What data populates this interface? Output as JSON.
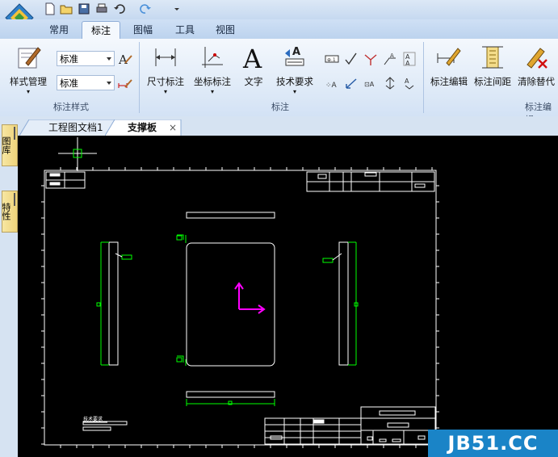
{
  "ribbon_tabs": [
    "常用",
    "标注",
    "图幅",
    "工具",
    "视图"
  ],
  "active_tab": "标注",
  "groups": {
    "style": {
      "label": "标注样式",
      "style_manager": "样式管理",
      "combo1": "标准",
      "combo2": "标准"
    },
    "annotation": {
      "label": "标注",
      "dim": "尺寸标注",
      "coord": "坐标标注",
      "text": "文字",
      "tech": "技术要求"
    },
    "edit": {
      "label": "标注编辑",
      "edit": "标注编辑",
      "spacing": "标注间距",
      "clear": "清除替代"
    }
  },
  "doc_tabs": [
    "工程图文档1",
    "支撑板"
  ],
  "active_doc": "支撑板",
  "side_tabs": [
    "图库",
    "特性"
  ],
  "drawing": {
    "tech_req_label": "技术要求"
  },
  "watermark": "JB51.CC",
  "colors": {
    "ribbon_bg": "#dde9f7",
    "line_white": "#ffffff",
    "line_green": "#00ff00",
    "axis_magenta": "#ff00ff",
    "watermark_bg": "#1a84c7"
  }
}
